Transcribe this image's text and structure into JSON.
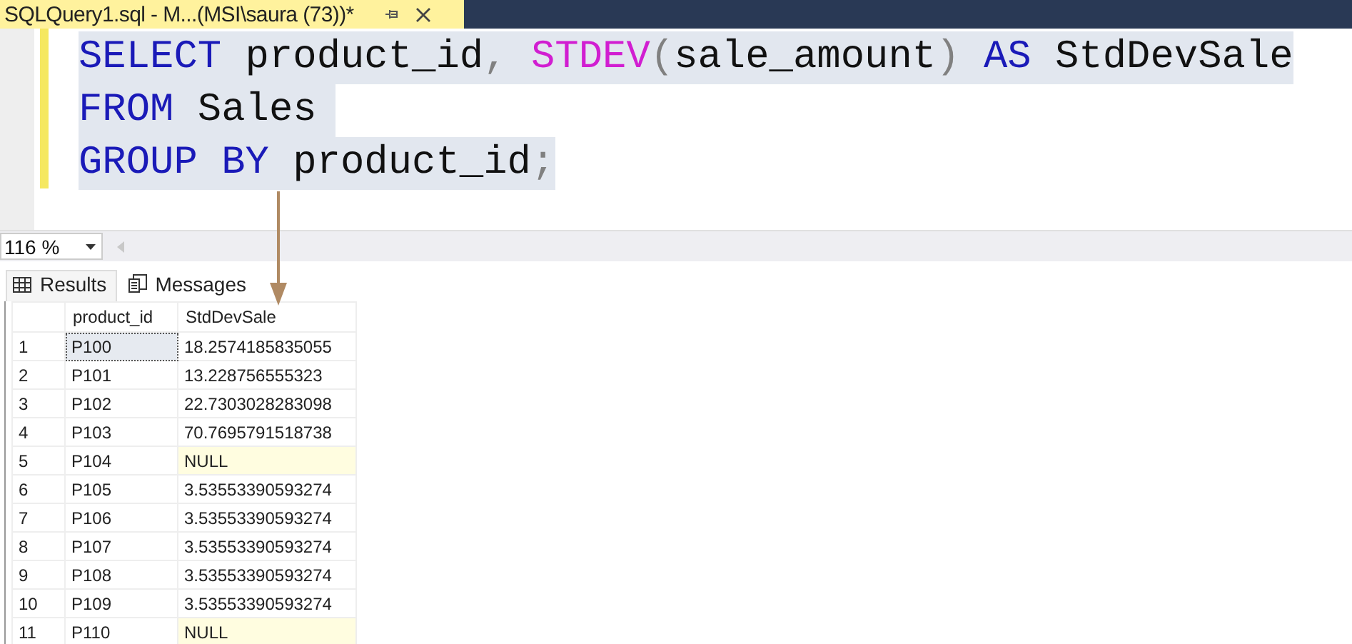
{
  "document_tab": {
    "title": "SQLQuery1.sql - M...(MSI\\saura (73))*"
  },
  "editor": {
    "lines": [
      [
        {
          "kind": "keyword",
          "text": "SELECT"
        },
        {
          "kind": "plain",
          "text": " product_id"
        },
        {
          "kind": "punct",
          "text": ", "
        },
        {
          "kind": "function",
          "text": "STDEV"
        },
        {
          "kind": "punct",
          "text": "("
        },
        {
          "kind": "plain",
          "text": "sale_amount"
        },
        {
          "kind": "punct",
          "text": ") "
        },
        {
          "kind": "keyword",
          "text": "AS"
        },
        {
          "kind": "plain",
          "text": " StdDevSale"
        }
      ],
      [
        {
          "kind": "keyword",
          "text": "FROM"
        },
        {
          "kind": "plain",
          "text": " Sales"
        }
      ],
      [
        {
          "kind": "keyword",
          "text": "GROUP BY"
        },
        {
          "kind": "plain",
          "text": " product_id"
        },
        {
          "kind": "punct",
          "text": ";"
        }
      ]
    ]
  },
  "zoom": {
    "value": "116 %"
  },
  "result_tabs": [
    {
      "label": "Results",
      "selected": true
    },
    {
      "label": "Messages",
      "selected": false
    }
  ],
  "grid": {
    "columns": [
      "product_id",
      "StdDevSale"
    ],
    "rows": [
      {
        "number": "1",
        "product_id": "P100",
        "std_dev_sale": "18.2574185835055",
        "focused": true,
        "highlighted": false
      },
      {
        "number": "2",
        "product_id": "P101",
        "std_dev_sale": "13.228756555323",
        "focused": false,
        "highlighted": false
      },
      {
        "number": "3",
        "product_id": "P102",
        "std_dev_sale": "22.7303028283098",
        "focused": false,
        "highlighted": false
      },
      {
        "number": "4",
        "product_id": "P103",
        "std_dev_sale": "70.7695791518738",
        "focused": false,
        "highlighted": false
      },
      {
        "number": "5",
        "product_id": "P104",
        "std_dev_sale": "NULL",
        "focused": false,
        "highlighted": true
      },
      {
        "number": "6",
        "product_id": "P105",
        "std_dev_sale": "3.53553390593274",
        "focused": false,
        "highlighted": false
      },
      {
        "number": "7",
        "product_id": "P106",
        "std_dev_sale": "3.53553390593274",
        "focused": false,
        "highlighted": false
      },
      {
        "number": "8",
        "product_id": "P107",
        "std_dev_sale": "3.53553390593274",
        "focused": false,
        "highlighted": false
      },
      {
        "number": "9",
        "product_id": "P108",
        "std_dev_sale": "3.53553390593274",
        "focused": false,
        "highlighted": false
      },
      {
        "number": "10",
        "product_id": "P109",
        "std_dev_sale": "3.53553390593274",
        "focused": false,
        "highlighted": false
      },
      {
        "number": "11",
        "product_id": "P110",
        "std_dev_sale": "NULL",
        "focused": false,
        "highlighted": true
      }
    ]
  }
}
